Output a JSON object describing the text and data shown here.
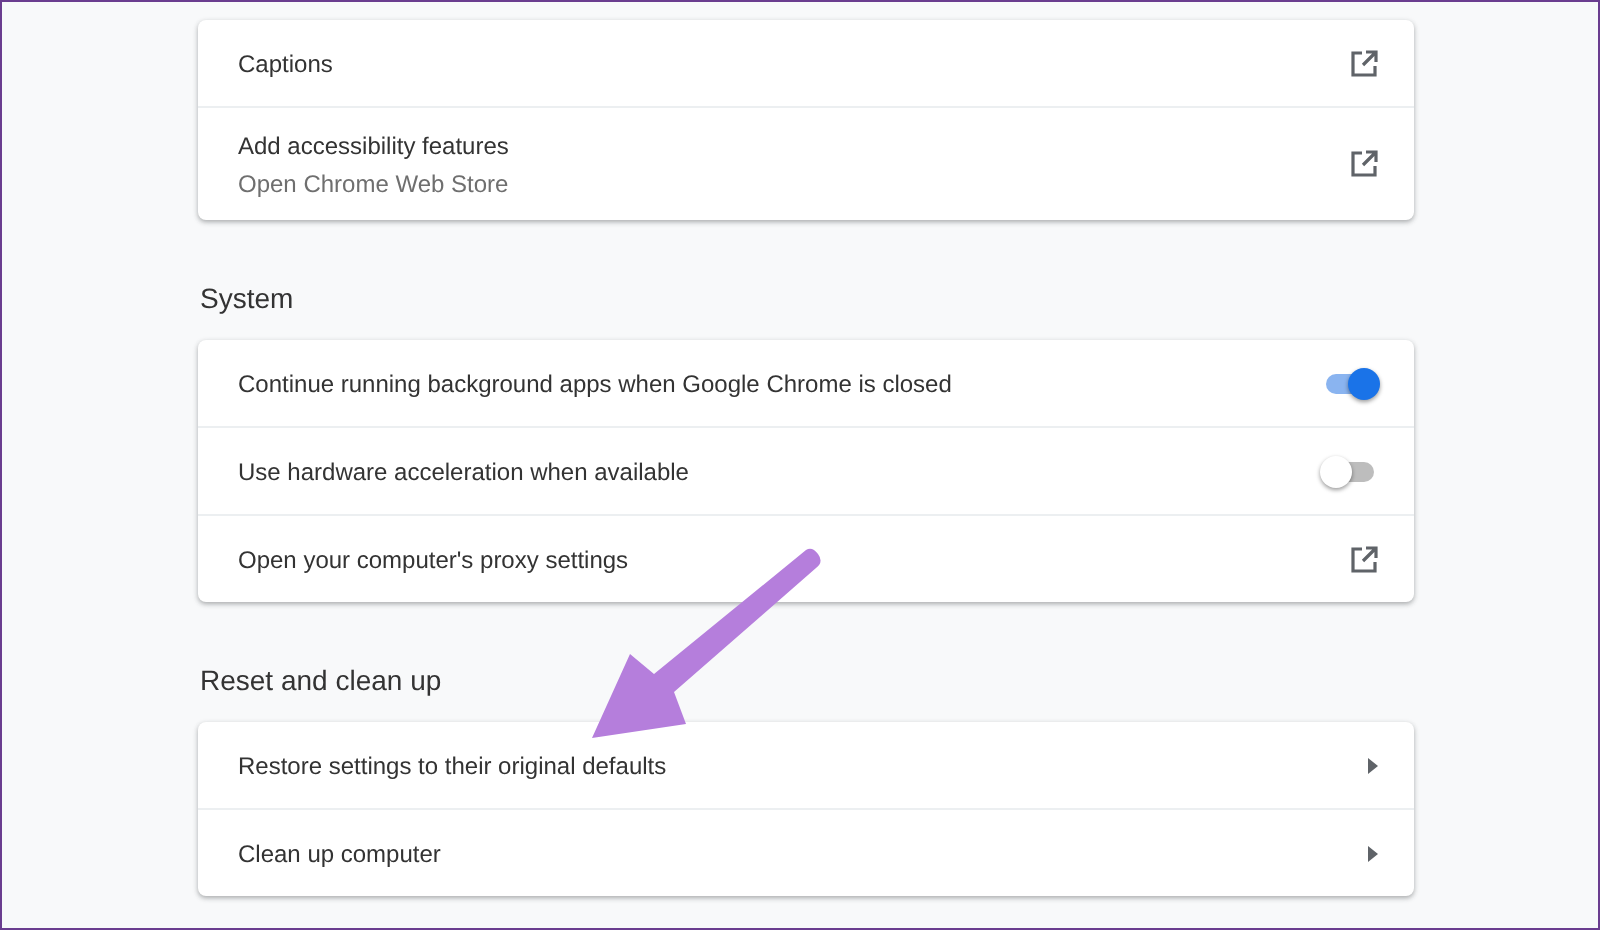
{
  "sections": [
    {
      "cards": [
        {
          "kind": "external",
          "label": "Captions"
        },
        {
          "kind": "external",
          "label": "Add accessibility features",
          "sublabel": "Open Chrome Web Store"
        }
      ]
    },
    {
      "heading": "System",
      "cards": [
        {
          "kind": "toggle",
          "label": "Continue running background apps when Google Chrome is closed",
          "on": true
        },
        {
          "kind": "toggle",
          "label": "Use hardware acceleration when available",
          "on": false
        },
        {
          "kind": "external",
          "label": "Open your computer's proxy settings"
        }
      ]
    },
    {
      "heading": "Reset and clean up",
      "cards": [
        {
          "kind": "submenu",
          "label": "Restore settings to their original defaults"
        },
        {
          "kind": "submenu",
          "label": "Clean up computer"
        }
      ]
    }
  ]
}
